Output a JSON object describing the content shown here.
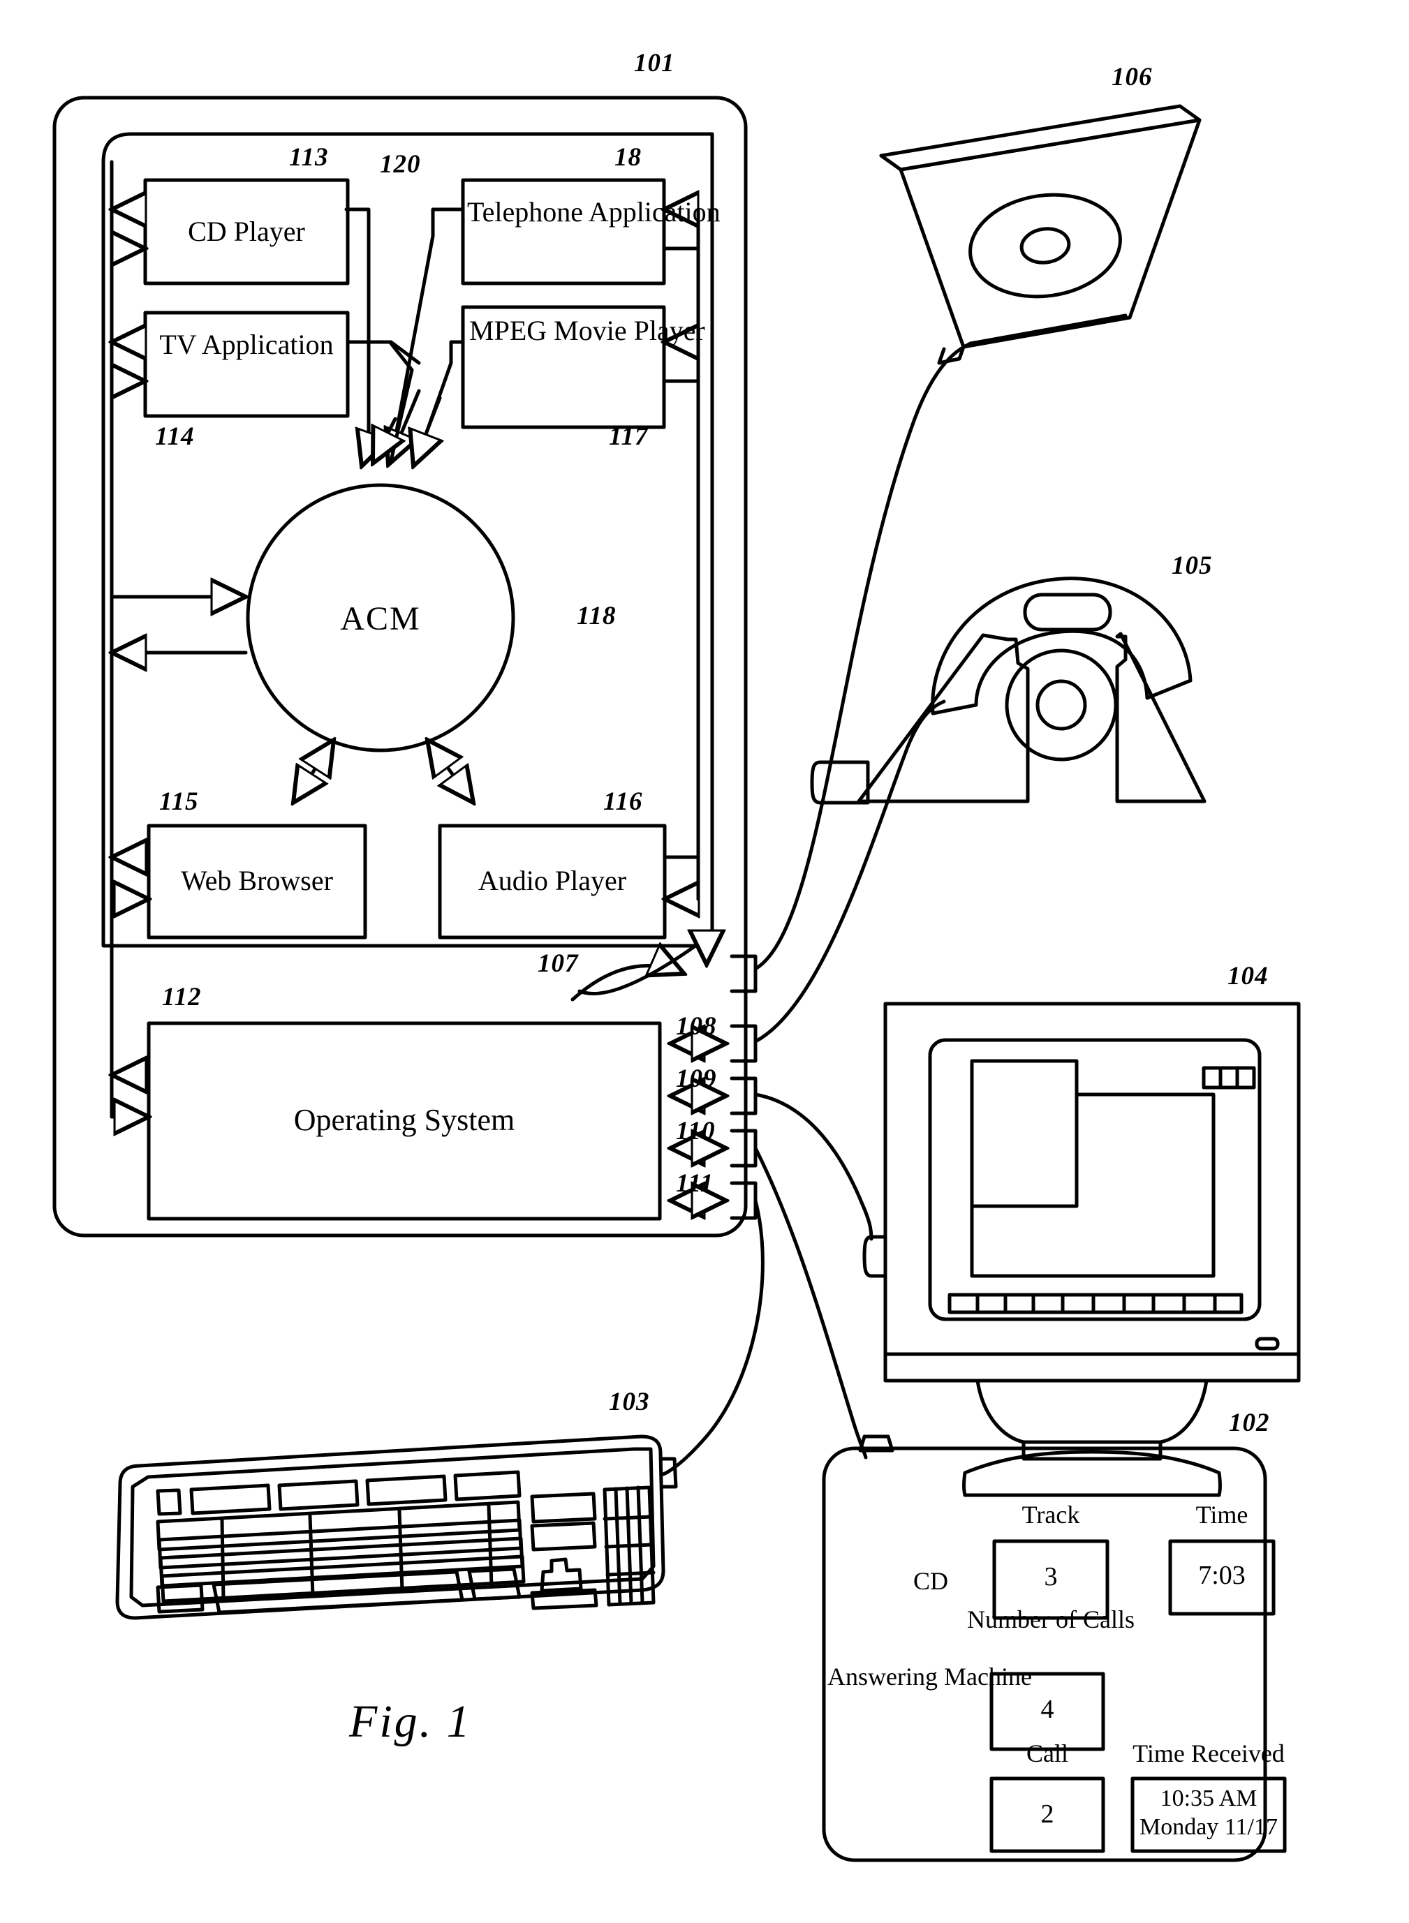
{
  "figure": {
    "caption": "Fig. 1",
    "system_ref": "101"
  },
  "computer": {
    "boundary_ref": "101",
    "applications_container_ref": "120",
    "apps": [
      {
        "name": "cd-player",
        "label": "CD Player",
        "ref": "113"
      },
      {
        "name": "telephone-application",
        "label": "Telephone Application",
        "ref": "18"
      },
      {
        "name": "tv-application",
        "label": "TV Application",
        "ref": "114"
      },
      {
        "name": "mpeg-movie-player",
        "label": "MPEG Movie Player",
        "ref": "117"
      },
      {
        "name": "web-browser",
        "label": "Web Browser",
        "ref": "115"
      },
      {
        "name": "audio-player",
        "label": "Audio Player",
        "ref": "116"
      }
    ],
    "acm": {
      "label": "ACM",
      "ref": "118"
    },
    "operating_system": {
      "label": "Operating System",
      "ref": "112"
    },
    "ports": [
      {
        "ref": "107",
        "name": "port-107"
      },
      {
        "ref": "108",
        "name": "port-108"
      },
      {
        "ref": "109",
        "name": "port-109"
      },
      {
        "ref": "110",
        "name": "port-110"
      },
      {
        "ref": "111",
        "name": "port-111"
      }
    ]
  },
  "peripherals": [
    {
      "name": "cd-drive",
      "ref": "106"
    },
    {
      "name": "telephone",
      "ref": "105"
    },
    {
      "name": "monitor",
      "ref": "104"
    },
    {
      "name": "keyboard",
      "ref": "103"
    },
    {
      "name": "display-panel",
      "ref": "102"
    }
  ],
  "display_panel": {
    "ref": "102",
    "rows": [
      {
        "device_label": "CD",
        "fields": [
          {
            "header": "Track",
            "value": "3"
          },
          {
            "header": "Time",
            "value": "7:03"
          }
        ]
      },
      {
        "device_label": "Answering Machine",
        "fields": [
          {
            "header": "Number of Calls",
            "value": "4"
          }
        ]
      },
      {
        "device_label": "",
        "fields": [
          {
            "header": "Call",
            "value": "2"
          },
          {
            "header": "Time Received",
            "value": "10:35 AM\nMonday 11/17",
            "value_line1": "10:35 AM",
            "value_line2": "Monday 11/17"
          }
        ]
      }
    ]
  },
  "colors": {
    "ink": "#000000",
    "paper": "#ffffff"
  }
}
